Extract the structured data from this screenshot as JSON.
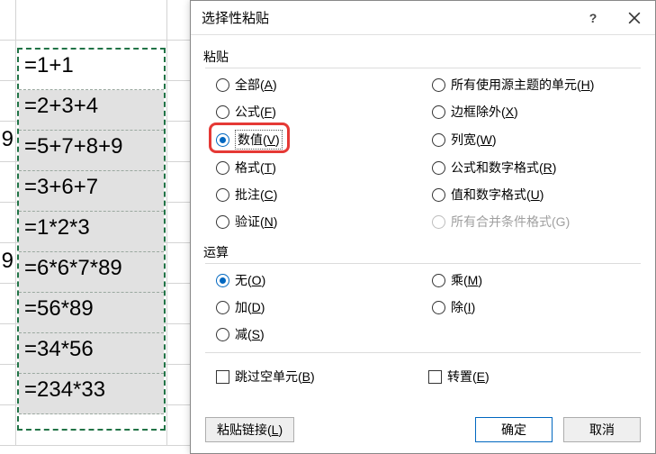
{
  "sheet": {
    "colA_visible_values": {
      "3": "9",
      "6": "9"
    },
    "formulas": [
      "=1+1",
      "=2+3+4",
      "=5+7+8+9",
      "=3+6+7",
      "=1*2*3",
      "=6*6*7*89",
      "=56*89",
      "=34*56",
      "=234*33"
    ]
  },
  "dialog": {
    "title": "选择性粘贴",
    "groups": {
      "paste": {
        "label": "粘贴",
        "options": [
          {
            "key": "all",
            "label": "全部",
            "hotkey": "A",
            "checked": false
          },
          {
            "key": "formulas",
            "label": "公式",
            "hotkey": "F",
            "checked": false
          },
          {
            "key": "values",
            "label": "数值",
            "hotkey": "V",
            "checked": true,
            "focused": true
          },
          {
            "key": "formats",
            "label": "格式",
            "hotkey": "T",
            "checked": false
          },
          {
            "key": "comments",
            "label": "批注",
            "hotkey": "C",
            "checked": false
          },
          {
            "key": "validation",
            "label": "验证",
            "hotkey": "N",
            "checked": false
          },
          {
            "key": "all_theme",
            "label": "所有使用源主题的单元",
            "hotkey": "H",
            "checked": false
          },
          {
            "key": "no_borders",
            "label": "边框除外",
            "hotkey": "X",
            "checked": false
          },
          {
            "key": "col_widths",
            "label": "列宽",
            "hotkey": "W",
            "checked": false
          },
          {
            "key": "formulas_num",
            "label": "公式和数字格式",
            "hotkey": "R",
            "checked": false
          },
          {
            "key": "values_num",
            "label": "值和数字格式",
            "hotkey": "U",
            "checked": false
          },
          {
            "key": "all_cond",
            "label": "所有合并条件格式",
            "hotkey": "G",
            "checked": false,
            "disabled": true
          }
        ]
      },
      "operation": {
        "label": "运算",
        "options": [
          {
            "key": "none",
            "label": "无",
            "hotkey": "O",
            "checked": true
          },
          {
            "key": "add",
            "label": "加",
            "hotkey": "D",
            "checked": false
          },
          {
            "key": "subtract",
            "label": "减",
            "hotkey": "S",
            "checked": false
          },
          {
            "key": "multiply",
            "label": "乘",
            "hotkey": "M",
            "checked": false
          },
          {
            "key": "divide",
            "label": "除",
            "hotkey": "I",
            "checked": false
          }
        ]
      }
    },
    "checks": {
      "skip_blanks": {
        "label": "跳过空单元",
        "hotkey": "B",
        "checked": false
      },
      "transpose": {
        "label": "转置",
        "hotkey": "E",
        "checked": false
      }
    },
    "buttons": {
      "paste_link": {
        "label": "粘贴链接",
        "hotkey": "L"
      },
      "ok": {
        "label": "确定"
      },
      "cancel": {
        "label": "取消"
      }
    }
  }
}
